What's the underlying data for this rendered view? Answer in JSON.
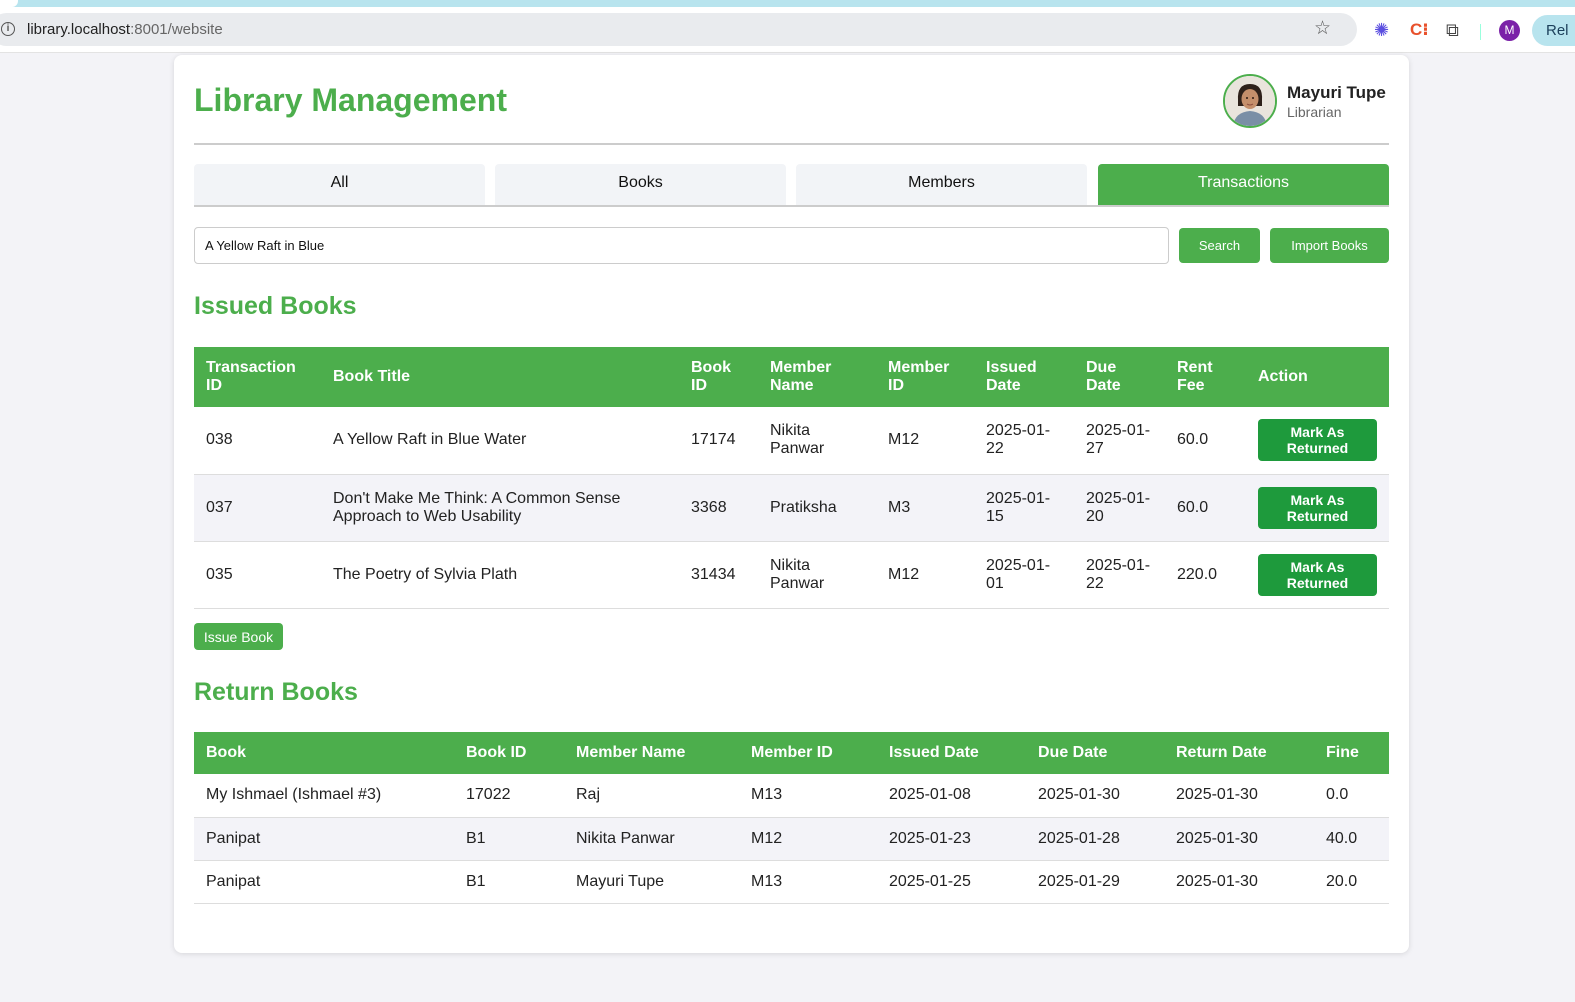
{
  "browser": {
    "url_host": "library.localhost",
    "url_rest": ":8001/website",
    "profile_initial": "M",
    "relaunch_label": "Rel"
  },
  "app": {
    "title": "Library Management",
    "user": {
      "name": "Mayuri Tupe",
      "role": "Librarian"
    }
  },
  "tabs": [
    {
      "label": "All"
    },
    {
      "label": "Books"
    },
    {
      "label": "Members"
    },
    {
      "label": "Transactions"
    }
  ],
  "search": {
    "value": "A Yellow Raft in Blue",
    "search_label": "Search",
    "import_label": "Import Books"
  },
  "issued": {
    "title": "Issued Books",
    "headers": [
      "Transaction ID",
      "Book Title",
      "Book ID",
      "Member Name",
      "Member ID",
      "Issued Date",
      "Due Date",
      "Rent Fee",
      "Action"
    ],
    "rows": [
      {
        "txn": "038",
        "title": "A Yellow Raft in Blue Water",
        "book_id": "17174",
        "member": "Nikita Panwar",
        "member_id": "M12",
        "issued": "2025-01-22",
        "due": "2025-01-27",
        "fee": "60.0",
        "action": "Mark As Returned"
      },
      {
        "txn": "037",
        "title": "Don't Make Me Think: A Common Sense Approach to Web Usability",
        "book_id": "3368",
        "member": "Pratiksha",
        "member_id": "M3",
        "issued": "2025-01-15",
        "due": "2025-01-20",
        "fee": "60.0",
        "action": "Mark As Returned"
      },
      {
        "txn": "035",
        "title": "The Poetry of Sylvia Plath",
        "book_id": "31434",
        "member": "Nikita Panwar",
        "member_id": "M12",
        "issued": "2025-01-01",
        "due": "2025-01-22",
        "fee": "220.0",
        "action": "Mark As Returned"
      }
    ],
    "issue_label": "Issue Book"
  },
  "returns": {
    "title": "Return Books",
    "headers": [
      "Book",
      "Book ID",
      "Member Name",
      "Member ID",
      "Issued Date",
      "Due Date",
      "Return Date",
      "Fine"
    ],
    "rows": [
      {
        "book": "My Ishmael (Ishmael #3)",
        "book_id": "17022",
        "member": "Raj",
        "member_id": "M13",
        "issued": "2025-01-08",
        "due": "2025-01-30",
        "returned": "2025-01-30",
        "fine": "0.0"
      },
      {
        "book": "Panipat",
        "book_id": "B1",
        "member": "Nikita Panwar",
        "member_id": "M12",
        "issued": "2025-01-23",
        "due": "2025-01-28",
        "returned": "2025-01-30",
        "fine": "40.0"
      },
      {
        "book": "Panipat",
        "book_id": "B1",
        "member": "Mayuri Tupe",
        "member_id": "M13",
        "issued": "2025-01-25",
        "due": "2025-01-29",
        "returned": "2025-01-30",
        "fine": "20.0"
      }
    ]
  },
  "colors": {
    "accent": "#4cae4c",
    "action_button": "#1e9a3c",
    "browser_accent": "#b8e4ee"
  }
}
